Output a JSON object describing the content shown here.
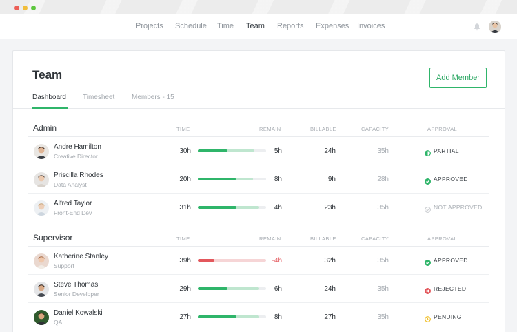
{
  "window": {
    "controls": [
      "close",
      "minimize",
      "maximize"
    ]
  },
  "nav": {
    "items": [
      {
        "label": "Projects",
        "active": false
      },
      {
        "label": "Schedule",
        "active": false
      },
      {
        "label": "Time",
        "active": false
      },
      {
        "label": "Team",
        "active": true
      },
      {
        "label": "Reports",
        "active": false
      },
      {
        "label": "Expenses",
        "active": false
      },
      {
        "label": "Invoices",
        "active": false
      }
    ],
    "icons": [
      "bell-icon",
      "user-avatar"
    ]
  },
  "page": {
    "title": "Team",
    "add_button": "Add Member",
    "tabs": [
      {
        "label": "Dashboard",
        "active": true
      },
      {
        "label": "Timesheet",
        "active": false
      },
      {
        "label": "Members - 15",
        "active": false
      }
    ]
  },
  "columns": {
    "time": "TIME",
    "remain": "REMAIN",
    "billable": "BILLABLE",
    "capacity": "CAPACITY",
    "approval": "APPROVAL"
  },
  "colors": {
    "accent": "#2fb56a",
    "accent_light": "#bfe6cf",
    "negative": "#e3575c",
    "negative_light": "#f6d5d6",
    "pending": "#f1c232",
    "muted": "#c9ccd0"
  },
  "groups": [
    {
      "name": "Admin",
      "members": [
        {
          "name": "Andre Hamilton",
          "role": "Creative Director",
          "time": "30h",
          "remain": "5h",
          "billable": "24h",
          "capacity": "35h",
          "approval": "PARTIAL",
          "status": "partial",
          "used_ratio": 0.43,
          "capacity_ratio": 0.83
        },
        {
          "name": "Priscilla Rhodes",
          "role": "Data Analyst",
          "time": "20h",
          "remain": "8h",
          "billable": "9h",
          "capacity": "28h",
          "approval": "APPROVED",
          "status": "approved",
          "used_ratio": 0.56,
          "capacity_ratio": 0.81
        },
        {
          "name": "Alfred Taylor",
          "role": "Front-End Dev",
          "time": "31h",
          "remain": "4h",
          "billable": "23h",
          "capacity": "35h",
          "approval": "NOT APPROVED",
          "status": "not-approved",
          "used_ratio": 0.57,
          "capacity_ratio": 0.9
        }
      ]
    },
    {
      "name": "Supervisor",
      "members": [
        {
          "name": "Katherine Stanley",
          "role": "Support",
          "time": "39h",
          "remain": "-4h",
          "billable": "32h",
          "capacity": "35h",
          "approval": "APPROVED",
          "status": "approved",
          "used_ratio": 0.24,
          "capacity_ratio": 1.0,
          "over": true
        },
        {
          "name": "Steve Thomas",
          "role": "Senior Developer",
          "time": "29h",
          "remain": "6h",
          "billable": "24h",
          "capacity": "35h",
          "approval": "REJECTED",
          "status": "rejected",
          "used_ratio": 0.43,
          "capacity_ratio": 0.9
        },
        {
          "name": "Daniel Kowalski",
          "role": "QA",
          "time": "27h",
          "remain": "8h",
          "billable": "27h",
          "capacity": "35h",
          "approval": "PENDING",
          "status": "pending",
          "used_ratio": 0.57,
          "capacity_ratio": 0.9
        }
      ]
    }
  ]
}
